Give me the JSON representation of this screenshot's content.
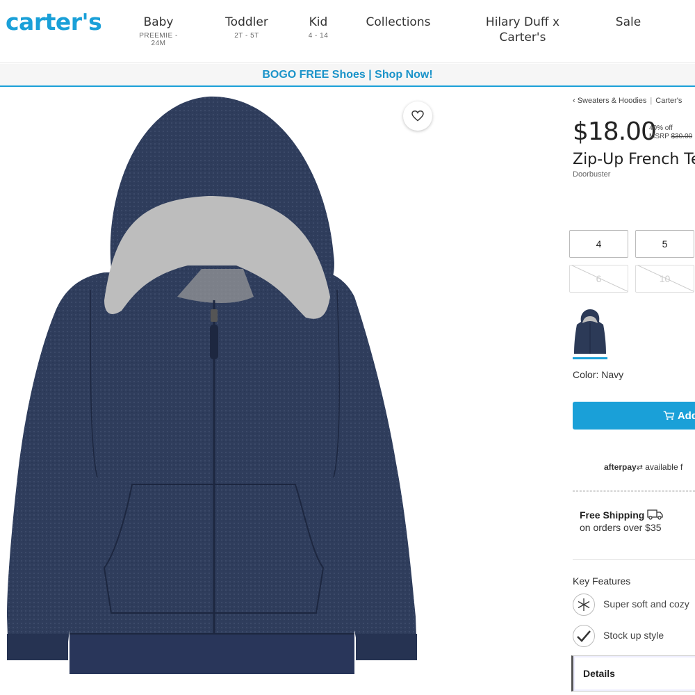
{
  "header": {
    "logo": "carter's",
    "nav": [
      {
        "label": "Baby",
        "sub": "PREEMIE - 24M"
      },
      {
        "label": "Toddler",
        "sub": "2T - 5T"
      },
      {
        "label": "Kid",
        "sub": "4 - 14"
      },
      {
        "label": "Collections",
        "sub": ""
      },
      {
        "label": "Hilary Duff x Carter's",
        "sub": ""
      },
      {
        "label": "Sale",
        "sub": ""
      }
    ]
  },
  "promo": {
    "text": "BOGO FREE Shoes | Shop Now!"
  },
  "product": {
    "breadcrumb": [
      "‹ Sweaters & Hoodies",
      "Carter's"
    ],
    "price": "$18.00",
    "discount": "40% off",
    "msrp_label": "MSRP",
    "msrp": "$30.00",
    "title": "Zip-Up French Te",
    "badge": "Doorbuster",
    "sizes": [
      {
        "label": "4",
        "available": true
      },
      {
        "label": "5",
        "available": true
      },
      {
        "label": "6",
        "available": false
      },
      {
        "label": "10",
        "available": false
      }
    ],
    "color_label": "Color: Navy",
    "add_button": "Add",
    "afterpay_brand": "afterpay",
    "afterpay_text": "available f",
    "shipping_title": "Free Shipping",
    "shipping_sub": "on orders over $35",
    "key_features_title": "Key Features",
    "features": [
      {
        "icon": "snowflake-icon",
        "text": "Super soft and cozy"
      },
      {
        "icon": "check-icon",
        "text": "Stock up style"
      }
    ],
    "details_label": "Details"
  },
  "colors": {
    "brand": "#1aa0d8",
    "hoodie": "#2c3a57",
    "lining": "#bdbdbd"
  }
}
